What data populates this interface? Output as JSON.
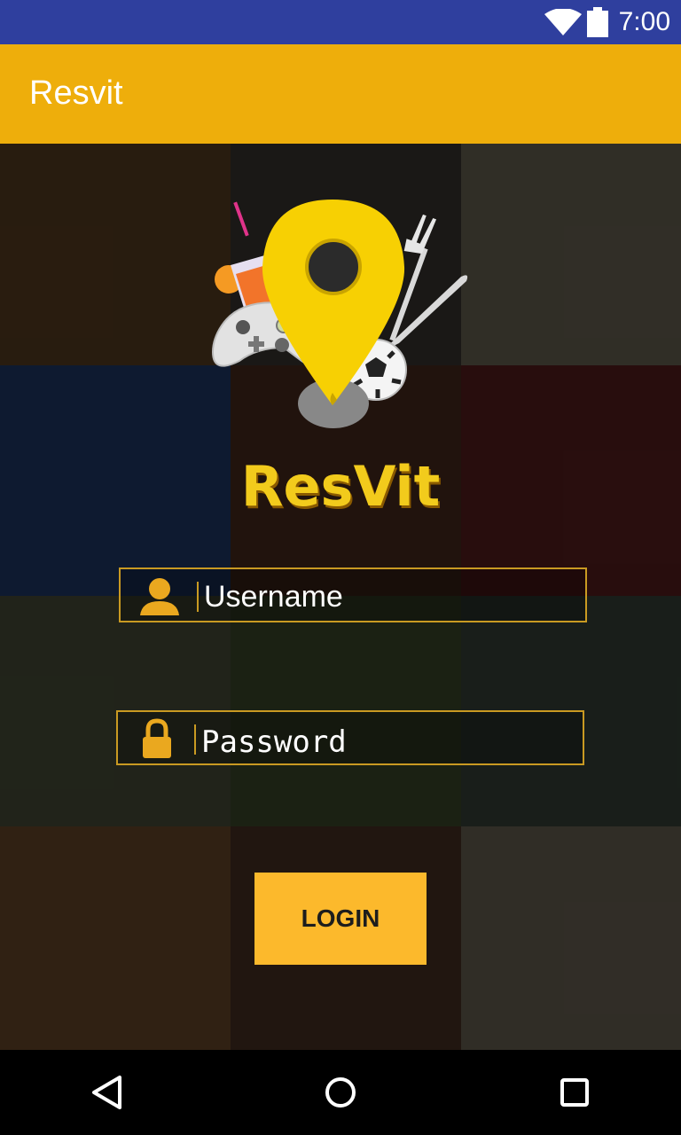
{
  "status_bar": {
    "time": "7:00",
    "wifi_icon": "wifi-icon",
    "battery_icon": "battery-icon"
  },
  "app_bar": {
    "title": "Resvit",
    "color": "#eeae0b"
  },
  "logo": {
    "brand_text": "ResVit",
    "icon": "map-pin-logo-icon"
  },
  "form": {
    "username_placeholder": "Username",
    "password_placeholder": "Password",
    "username_icon": "user-icon",
    "password_icon": "lock-icon",
    "border_color": "#c99a22"
  },
  "login_button": {
    "label": "LOGIN",
    "color": "#fcb92c"
  },
  "nav_bar": {
    "back_icon": "back-triangle-icon",
    "home_icon": "home-circle-icon",
    "recents_icon": "recents-square-icon"
  }
}
